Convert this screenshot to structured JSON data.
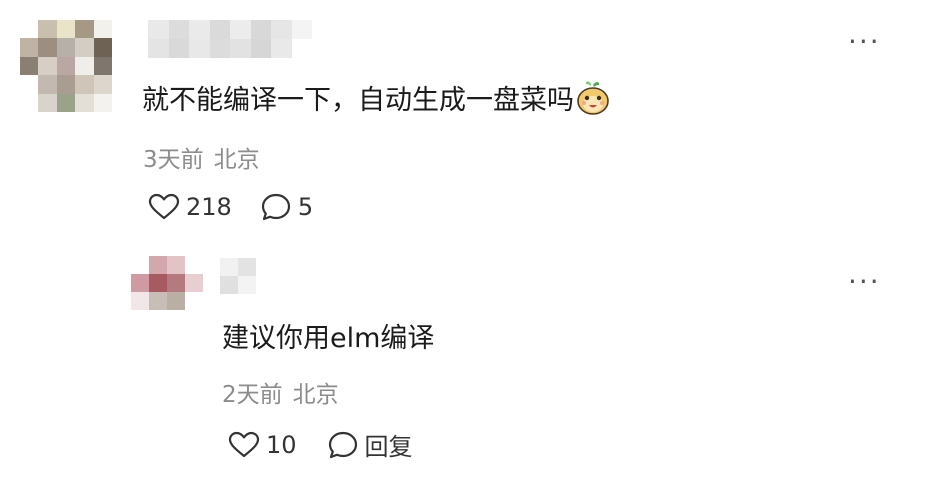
{
  "comment": {
    "text": "就不能编译一下，自动生成一盘菜吗",
    "emoji_icon": "smiling-pet-emoji-icon",
    "time": "3天前",
    "location": "北京",
    "likes": "218",
    "replies": "5",
    "more": "···"
  },
  "reply": {
    "text": "建议你用elm编译",
    "time": "2天前",
    "location": "北京",
    "likes": "10",
    "reply_label": "回复",
    "more": "···"
  },
  "colors": {
    "text": "#1b1b1b",
    "meta": "#8c8c8c",
    "icon": "#333333"
  }
}
